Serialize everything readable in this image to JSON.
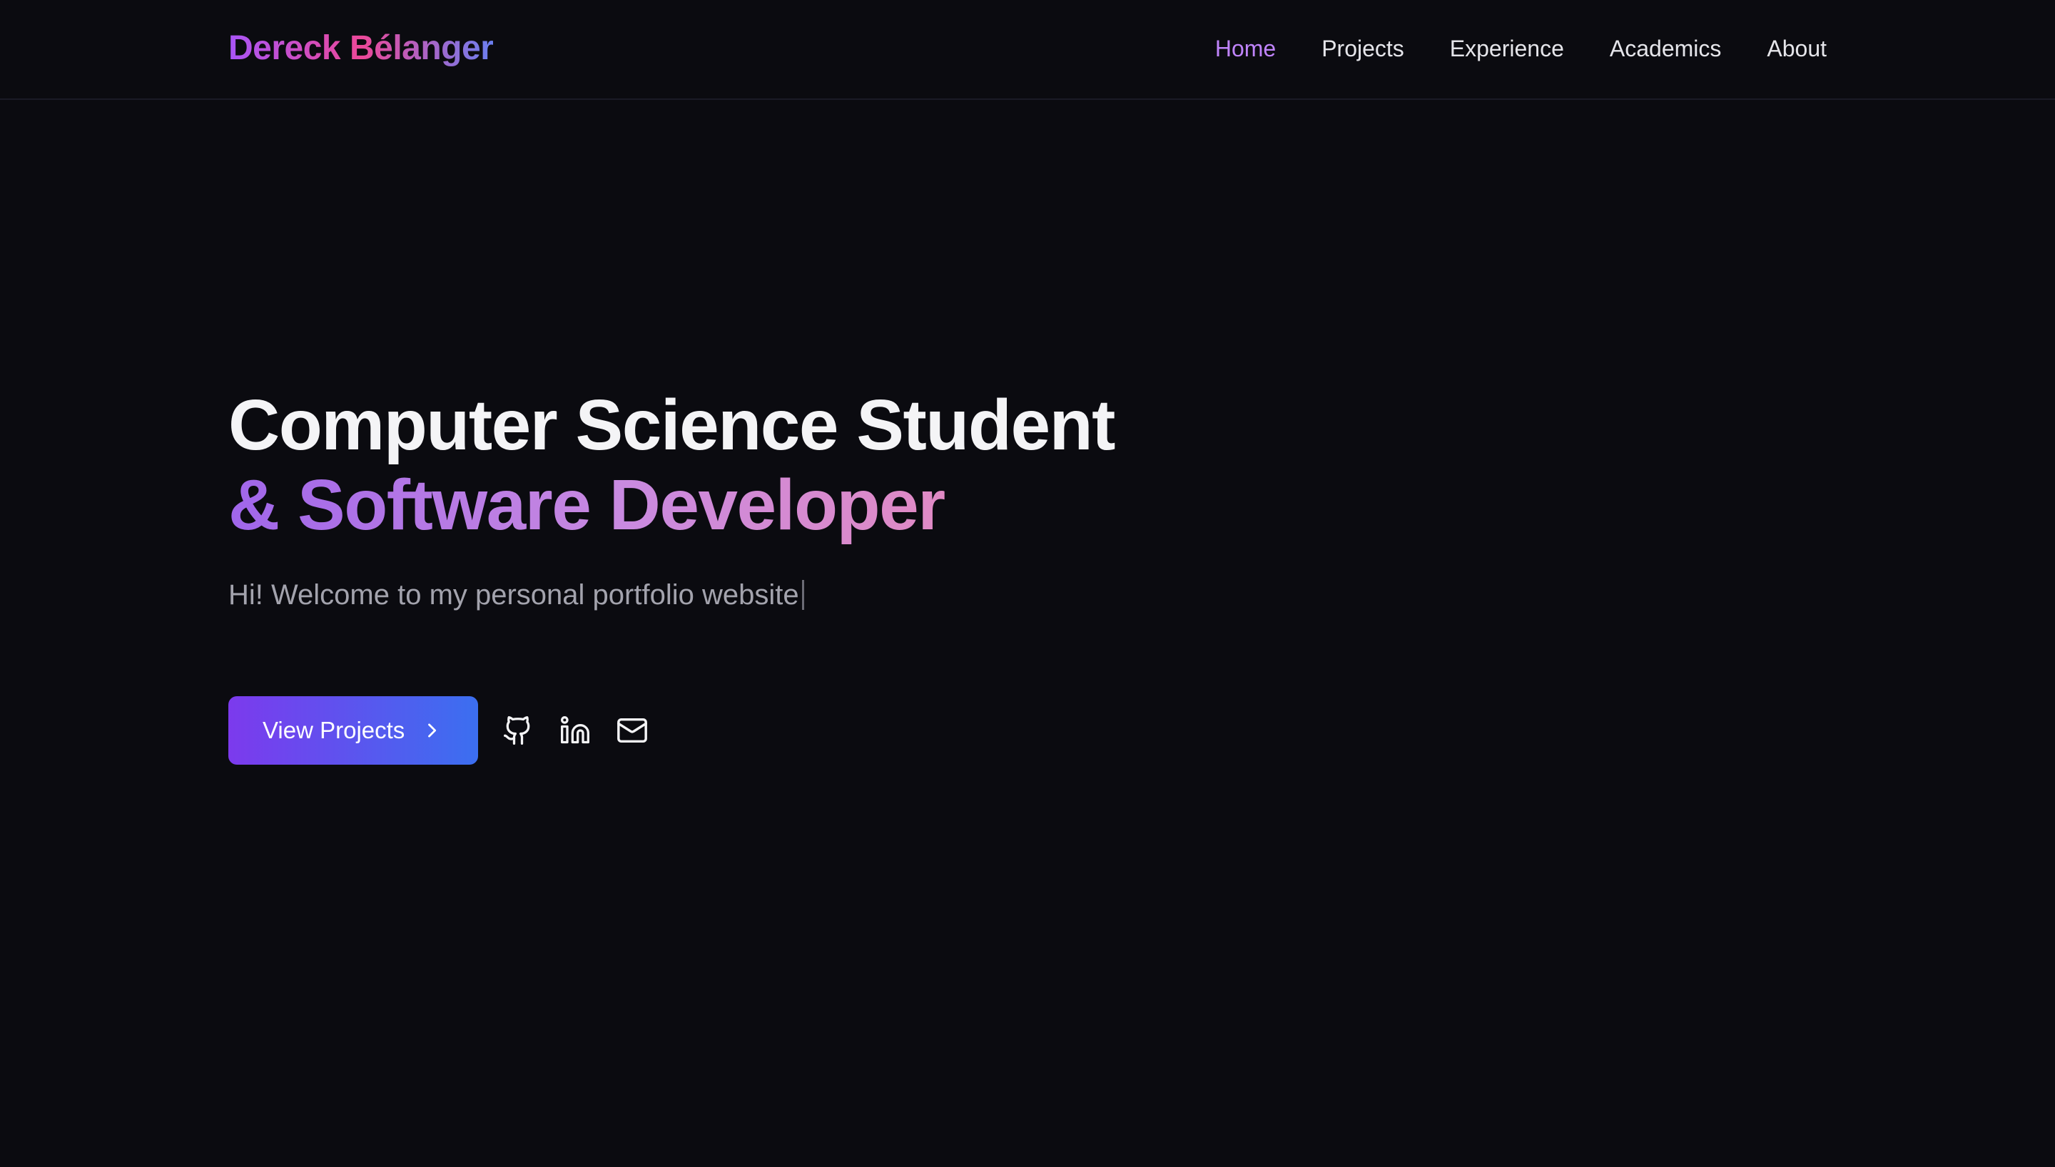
{
  "header": {
    "brand": "Dereck Bélanger",
    "nav": [
      {
        "label": "Home",
        "active": true
      },
      {
        "label": "Projects",
        "active": false
      },
      {
        "label": "Experience",
        "active": false
      },
      {
        "label": "Academics",
        "active": false
      },
      {
        "label": "About",
        "active": false
      }
    ]
  },
  "hero": {
    "headline_line1": "Computer Science Student",
    "headline_line2": "& Software Developer",
    "subtitle": "Hi! Welcome to my personal portfolio website",
    "cta_label": "View Projects",
    "cta_icon": "chevron-right-icon",
    "social_icons": [
      "github-icon",
      "linkedin-icon",
      "mail-icon"
    ]
  },
  "colors": {
    "background": "#0b0b10",
    "accent_purple": "#c084fc",
    "cta_gradient_start": "#7c3aed",
    "cta_gradient_end": "#3b6ff0"
  }
}
